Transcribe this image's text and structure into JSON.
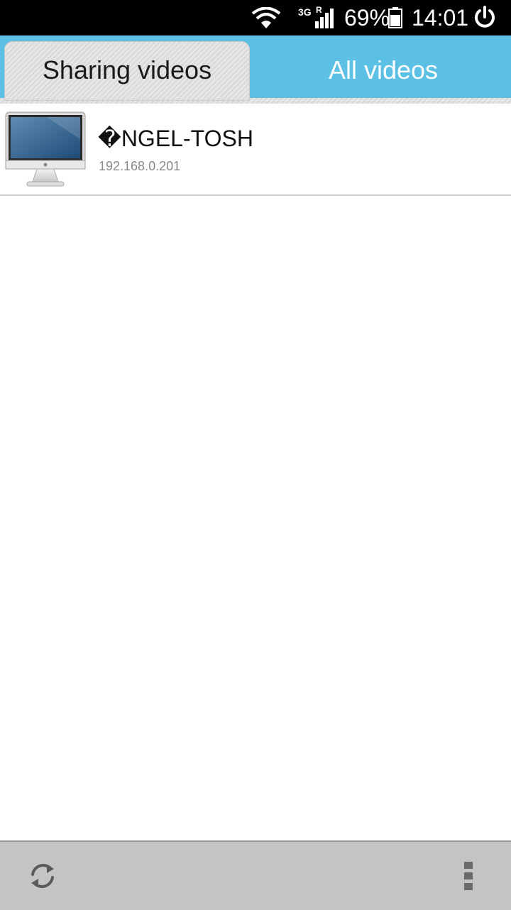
{
  "status_bar": {
    "network_type": "3G",
    "roaming": "R",
    "battery_percent": "69%",
    "time": "14:01",
    "icons": [
      "wifi-icon",
      "signal-icon",
      "battery-icon",
      "power-icon"
    ]
  },
  "tabs": [
    {
      "label": "Sharing videos",
      "selected": true
    },
    {
      "label": "All videos",
      "selected": false
    }
  ],
  "devices": [
    {
      "name": "�NGEL-TOSH",
      "ip": "192.168.0.201",
      "icon": "monitor-icon"
    }
  ],
  "bottom_bar": {
    "icons": [
      "refresh-icon",
      "overflow-menu-icon"
    ]
  },
  "colors": {
    "tab_bar": "#5cc0e4",
    "status_bar": "#000000",
    "bottom_bar": "#c4c4c4"
  }
}
